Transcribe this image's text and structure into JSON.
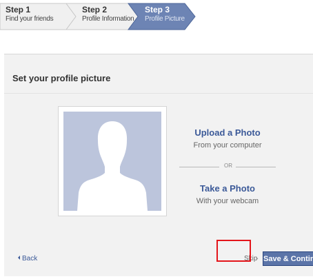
{
  "steps": [
    {
      "number": "Step 1",
      "subtitle": "Find your friends"
    },
    {
      "number": "Step 2",
      "subtitle": "Profile Information"
    },
    {
      "number": "Step 3",
      "subtitle": "Profile Picture"
    }
  ],
  "active_step": 3,
  "panel": {
    "title": "Set your profile picture",
    "upload_title": "Upload a Photo",
    "upload_subtitle": "From your computer",
    "or_text": "OR",
    "take_title": "Take a Photo",
    "take_subtitle": "With your webcam"
  },
  "footer": {
    "back_label": "Back",
    "skip_label": "Skip",
    "skip_separator": "·",
    "save_label": "Save & Continue"
  },
  "colors": {
    "accent": "#3b5998",
    "active_step": "#6d84b4",
    "button": "#5b74a8",
    "highlight": "#e4141a",
    "avatar_bg": "#bcc5dc"
  },
  "icons": {
    "avatar": "default-profile-silhouette-icon",
    "back": "left-arrow-icon"
  }
}
